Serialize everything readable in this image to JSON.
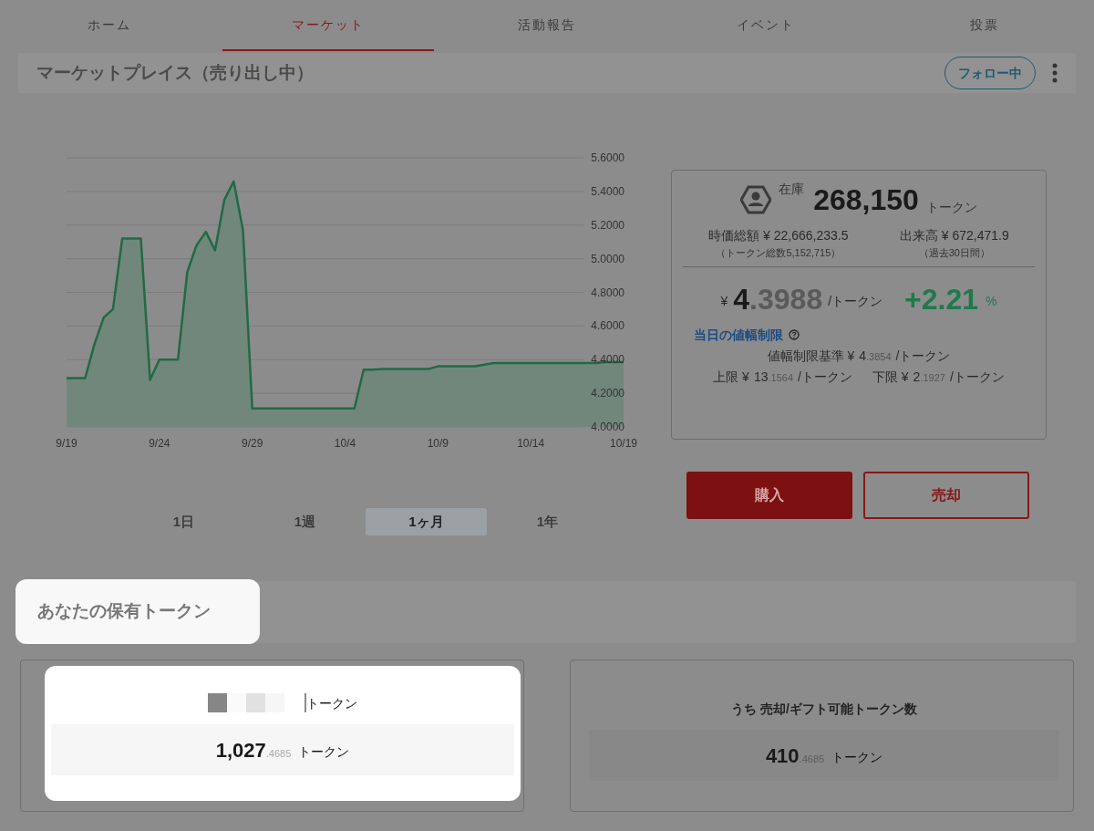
{
  "tabs": [
    {
      "label": "ホーム",
      "selected": false
    },
    {
      "label": "マーケット",
      "selected": true
    },
    {
      "label": "活動報告",
      "selected": false
    },
    {
      "label": "イベント",
      "selected": false
    },
    {
      "label": "投票",
      "selected": false
    }
  ],
  "header": {
    "title": "マーケットプレイス（売り出し中）",
    "follow_button": "フォロー中"
  },
  "chart": {
    "chart_data": {
      "type": "area",
      "categories": [
        "9/19",
        null,
        null,
        null,
        null,
        null,
        null,
        null,
        null,
        null,
        "9/24",
        null,
        null,
        null,
        null,
        null,
        null,
        null,
        null,
        null,
        "9/29",
        null,
        null,
        null,
        null,
        null,
        null,
        null,
        null,
        null,
        "10/4",
        null,
        null,
        null,
        null,
        null,
        null,
        null,
        null,
        null,
        "10/9",
        null,
        null,
        null,
        null,
        null,
        null,
        null,
        null,
        null,
        "10/14",
        null,
        null,
        null,
        null,
        null,
        null,
        null,
        null,
        null,
        "10/19"
      ],
      "series": [
        {
          "color": "#1f6b45",
          "values": [
            4.29,
            4.29,
            4.29,
            4.49,
            4.65,
            4.7,
            5.12,
            5.12,
            5.12,
            4.28,
            4.4,
            4.4,
            4.4,
            4.92,
            5.08,
            5.16,
            5.05,
            5.35,
            5.46,
            5.17,
            4.11,
            4.11,
            4.11,
            4.11,
            4.11,
            4.11,
            4.11,
            4.11,
            4.11,
            4.11,
            4.11,
            4.11,
            4.34,
            4.34,
            4.345,
            4.345,
            4.345,
            4.345,
            4.345,
            4.345,
            4.36,
            4.36,
            4.36,
            4.36,
            4.36,
            4.37,
            4.38,
            4.38,
            4.38,
            4.38,
            4.38,
            4.38,
            4.38,
            4.38,
            4.38,
            4.38,
            4.38,
            4.38,
            4.385,
            4.385,
            4.385
          ]
        }
      ],
      "ylim": [
        4.0,
        5.6
      ],
      "grid": true,
      "yticks": [
        {
          "value": 4.0,
          "label": "4.0000"
        },
        {
          "value": 4.2,
          "label": "4.2000"
        },
        {
          "value": 4.4,
          "label": "4.4000"
        },
        {
          "value": 4.6,
          "label": "4.6000"
        },
        {
          "value": 4.8,
          "label": "4.8000"
        },
        {
          "value": 5.0,
          "label": "5.0000"
        },
        {
          "value": 5.2,
          "label": "5.2000"
        },
        {
          "value": 5.4,
          "label": "5.4000"
        },
        {
          "value": 5.6,
          "label": "5.6000"
        }
      ]
    }
  },
  "periods": [
    {
      "label": "1日",
      "selected": false
    },
    {
      "label": "1週",
      "selected": false
    },
    {
      "label": "1ヶ月",
      "selected": true
    },
    {
      "label": "1年",
      "selected": false
    }
  ],
  "info": {
    "stock_label": "在庫",
    "stock_value": "268,150",
    "stock_unit": "トークン",
    "market_cap": {
      "label": "時価総額 ¥ 22,666,233.5",
      "note": "（トークン総数5,152,715）"
    },
    "volume": {
      "label": "出来高 ¥ 672,471.9",
      "note": "（過去30日間）"
    },
    "price": {
      "currency": "¥",
      "int": "4",
      "frac": ".3988",
      "unit": "/トークン"
    },
    "change": {
      "value": "+2.21",
      "unit": "%"
    },
    "limit_title": "当日の値幅制限",
    "limits": [
      {
        "label": "値幅制限基準 ¥",
        "int": "4",
        "frac": ".3854",
        "unit": "/トークン"
      },
      {
        "label": "上限 ¥",
        "int": "13",
        "frac": ".1564",
        "unit": "/トークン"
      },
      {
        "label": "下限 ¥",
        "int": "2",
        "frac": ".1927",
        "unit": "/トークン"
      }
    ]
  },
  "actions": {
    "buy": "購入",
    "sell": "売却"
  },
  "holdings": {
    "title": "あなたの保有トークン",
    "cards": [
      {
        "label": "トークン",
        "int": "1,027",
        "frac": ".4685",
        "unit": "トークン",
        "highlighted": true
      },
      {
        "label": "うち 売却/ギフト可能トークン数",
        "int": "410",
        "frac": ".4685",
        "unit": "トークン",
        "highlighted": false
      }
    ]
  }
}
